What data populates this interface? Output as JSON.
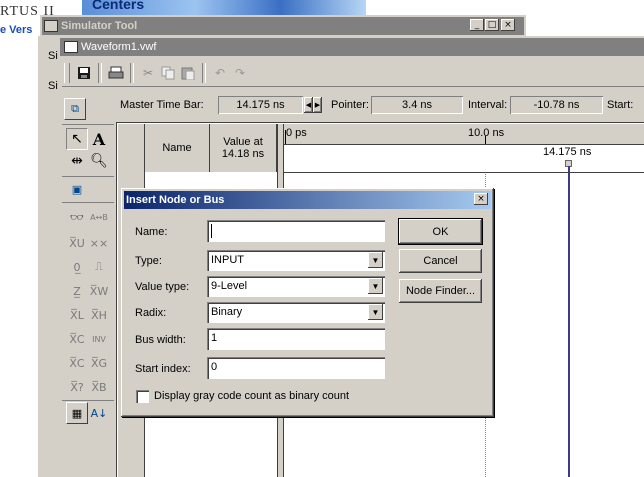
{
  "background": {
    "brand_fragment": "RTUS II",
    "version_fragment": "e Vers",
    "centers_fragment": "Centers",
    "left_letters": [
      "Si",
      "Si"
    ]
  },
  "simulator_window": {
    "title": "Simulator Tool",
    "controls": [
      "_",
      "□",
      "×"
    ]
  },
  "waveform_window": {
    "title": "Waveform1.vwf"
  },
  "timebar": {
    "master_label": "Master Time Bar:",
    "master_value": "14.175 ns",
    "pointer_label": "Pointer:",
    "pointer_value": "3.4 ns",
    "interval_label": "Interval:",
    "interval_value": "-10.78 ns",
    "start_label": "Start:"
  },
  "grid": {
    "name_header": "Name",
    "value_header_line1": "Value at",
    "value_header_line2": "14.18 ns",
    "ruler_start": "0 ps",
    "ruler_mid": "10.0 ns",
    "cursor_label": "14.175 ns"
  },
  "dialog": {
    "title": "Insert Node or Bus",
    "name_label": "Name:",
    "name_value": "",
    "type_label": "Type:",
    "type_value": "INPUT",
    "value_type_label": "Value type:",
    "value_type_value": "9-Level",
    "radix_label": "Radix:",
    "radix_value": "Binary",
    "bus_width_label": "Bus width:",
    "bus_width_value": "1",
    "start_index_label": "Start index:",
    "start_index_value": "0",
    "checkbox_label": "Display gray code count as binary count",
    "checkbox_checked": false,
    "ok": "OK",
    "cancel": "Cancel",
    "node_finder": "Node Finder..."
  },
  "colors": {
    "titlebar_active_start": "#0a246a",
    "titlebar_active_end": "#a6caf0",
    "titlebar_inactive": "#808080",
    "face": "#d4d0c8",
    "cursor_line": "#3a3a8c"
  }
}
